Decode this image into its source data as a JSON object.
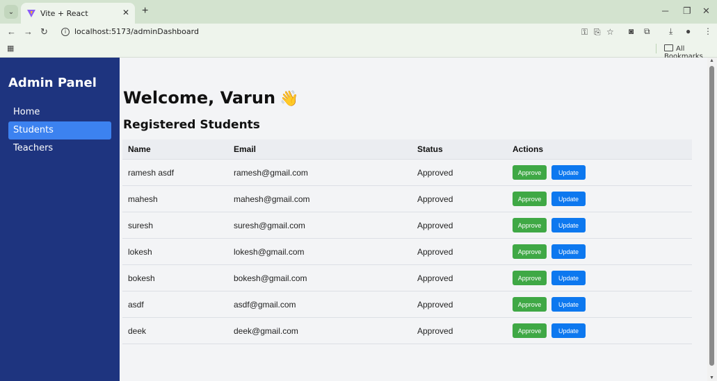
{
  "browser": {
    "tab_title": "Vite + React",
    "url": "localhost:5173/adminDashboard",
    "all_bookmarks": "All Bookmarks"
  },
  "sidebar": {
    "title": "Admin Panel",
    "items": [
      {
        "label": "Home",
        "active": false
      },
      {
        "label": "Students",
        "active": true
      },
      {
        "label": "Teachers",
        "active": false
      }
    ]
  },
  "main": {
    "welcome": "Welcome, Varun",
    "wave": "👋",
    "section_title": "Registered Students",
    "columns": [
      "Name",
      "Email",
      "Status",
      "Actions"
    ],
    "rows": [
      {
        "name": "ramesh asdf",
        "email": "ramesh@gmail.com",
        "status": "Approved"
      },
      {
        "name": "mahesh",
        "email": "mahesh@gmail.com",
        "status": "Approved"
      },
      {
        "name": "suresh",
        "email": "suresh@gmail.com",
        "status": "Approved"
      },
      {
        "name": "lokesh",
        "email": "lokesh@gmail.com",
        "status": "Approved"
      },
      {
        "name": "bokesh",
        "email": "bokesh@gmail.com",
        "status": "Approved"
      },
      {
        "name": "asdf",
        "email": "asdf@gmail.com",
        "status": "Approved"
      },
      {
        "name": "deek",
        "email": "deek@gmail.com",
        "status": "Approved"
      }
    ],
    "approve_label": "Approve",
    "update_label": "Update"
  },
  "colors": {
    "sidebar": "#1e347f",
    "active_item": "#3c82f0",
    "approve": "#3fa845",
    "update": "#0d78ef"
  }
}
